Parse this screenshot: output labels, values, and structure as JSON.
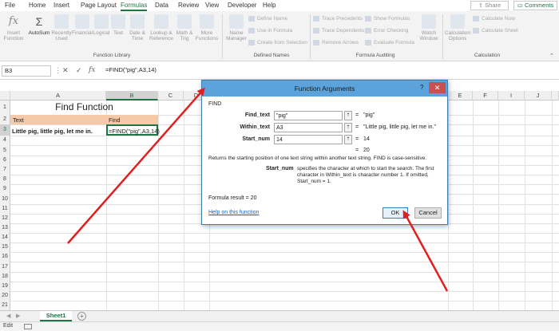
{
  "ribbon_tabs": [
    "File",
    "Home",
    "Insert",
    "Page Layout",
    "Formulas",
    "Data",
    "Review",
    "View",
    "Developer",
    "Help"
  ],
  "active_tab": "Formulas",
  "share_label": "Share",
  "comments_label": "Comments",
  "ribbon": {
    "insert_function": "Insert\nFunction",
    "autosum": "AutoSum",
    "recently_used": "Recently\nUsed",
    "financial": "Financial",
    "logical": "Logical",
    "text": "Text",
    "date_time": "Date &\nTime",
    "lookup_reference": "Lookup &\nReference",
    "math_trig": "Math &\nTrig",
    "more_functions": "More\nFunctions",
    "group_function_library": "Function Library",
    "name_manager": "Name\nManager",
    "define_name": "Define Name",
    "use_in_formula": "Use in Formula",
    "create_from_selection": "Create from Selection",
    "group_defined_names": "Defined Names",
    "trace_precedents": "Trace Precedents",
    "trace_dependents": "Trace Dependents",
    "remove_arrows": "Remove Arrows",
    "show_formulas": "Show Formulas",
    "error_checking": "Error Checking",
    "evaluate_formula": "Evaluate Formula",
    "watch_window": "Watch\nWindow",
    "group_formula_auditing": "Formula Auditing",
    "calculation_options": "Calculation\nOptions",
    "calculate_now": "Calculate Now",
    "calculate_sheet": "Calculate Sheet",
    "group_calculation": "Calculation"
  },
  "formula_bar": {
    "name_box": "B3",
    "cancel_glyph": "✕",
    "enter_glyph": "✓",
    "fx_glyph": "fx",
    "formula": "=FIND(\"pig\",A3,14)"
  },
  "columns": [
    "A",
    "B",
    "C",
    "D",
    "E",
    "F",
    "G",
    "H",
    "I",
    "J"
  ],
  "rows": [
    "1",
    "2",
    "3",
    "4",
    "5",
    "6",
    "7",
    "8",
    "9",
    "10",
    "11",
    "12",
    "13",
    "14",
    "15",
    "16",
    "17",
    "18",
    "19",
    "20",
    "21"
  ],
  "cells": {
    "title": "Find Function",
    "header_text": "Text",
    "header_find": "Find",
    "a3": "Little pig, little pig, let me in.",
    "b3": "=FIND(\"pig\",A3,14)"
  },
  "sheet_tab": "Sheet1",
  "status": "Edit",
  "dialog": {
    "title": "Function Arguments",
    "help": "?",
    "close": "✕",
    "function_name": "FIND",
    "args": [
      {
        "label": "Find_text",
        "value": "\"pig\"",
        "result": "\"pig\""
      },
      {
        "label": "Within_text",
        "value": "A3",
        "result": "\"Little pig, little pig, let me in.\""
      },
      {
        "label": "Start_num",
        "value": "14",
        "result": "14"
      }
    ],
    "eq": "=",
    "overall_result": "20",
    "description": "Returns the starting position of one text string within another text string. FIND is case-sensitive.",
    "arg_help_name": "Start_num",
    "arg_help_text": "specifies the character at which to start the search. The first character in Within_text is character number 1. If omitted, Start_num = 1.",
    "formula_result_label": "Formula result =",
    "formula_result_value": "20",
    "help_link": "Help on this function",
    "ok": "OK",
    "cancel": "Cancel"
  },
  "colors": {
    "accent": "#217346",
    "arrow": "#e02020",
    "header_fill": "#f6c9a8",
    "dialog_title": "#5ba3da"
  }
}
